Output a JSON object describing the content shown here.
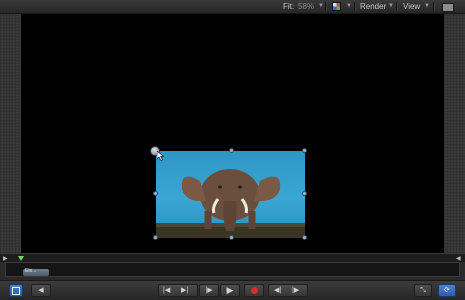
{
  "topbar": {
    "fit_label": "Fit:",
    "fit_value": "58%",
    "render_label": "Render",
    "view_label": "View"
  },
  "timeline": {
    "clip_label": "Ele..."
  },
  "colors": {
    "canvas": "#000000",
    "accent_blue": "#3a6cc4",
    "record_red": "#d03030",
    "playhead_green": "#6ad86a"
  },
  "icons": [
    "color-channels-icon",
    "layout-icon",
    "play-range-start-icon",
    "step-back-icon",
    "go-start-icon",
    "play-icon",
    "record-icon",
    "prev-keyframe-icon",
    "next-keyframe-icon",
    "fullscreen-icon",
    "loop-icon"
  ]
}
